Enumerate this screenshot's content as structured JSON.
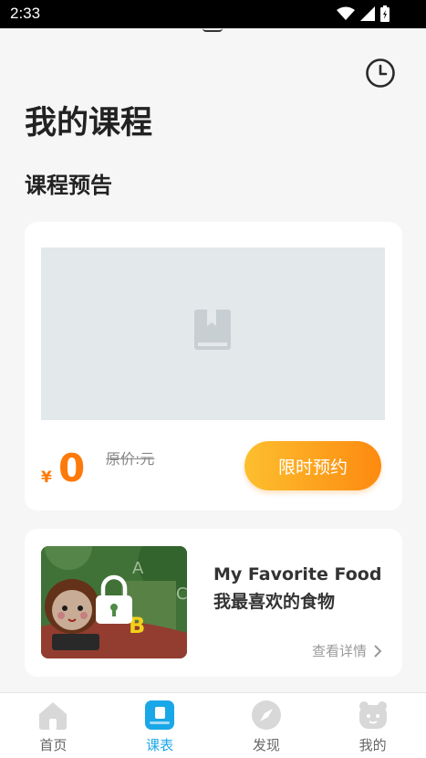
{
  "status_bar": {
    "time": "2:33"
  },
  "header": {
    "title": "我的课程",
    "history_icon": "clock-icon"
  },
  "preview_section": {
    "title": "课程预告",
    "card": {
      "image_icon": "book-icon",
      "currency": "¥",
      "price": "0",
      "original_price": "原价:元",
      "reserve_label": "限时预约"
    }
  },
  "course_card": {
    "title": "My Favorite Food 我最喜欢的食物",
    "detail_label": "查看详情",
    "thumb_letters": [
      "A",
      "B",
      "C"
    ]
  },
  "tabbar": {
    "tabs": [
      {
        "label": "首页",
        "icon": "home-icon"
      },
      {
        "label": "课表",
        "icon": "schedule-icon"
      },
      {
        "label": "发现",
        "icon": "compass-icon"
      },
      {
        "label": "我的",
        "icon": "profile-icon"
      }
    ],
    "active_color": "#1aa7e8",
    "inactive_icon_color": "#d8d8d8"
  },
  "colors": {
    "accent_orange": "#fd7a0a",
    "button_gradient_start": "#fdbf2e",
    "button_gradient_end": "#fd8a10"
  }
}
